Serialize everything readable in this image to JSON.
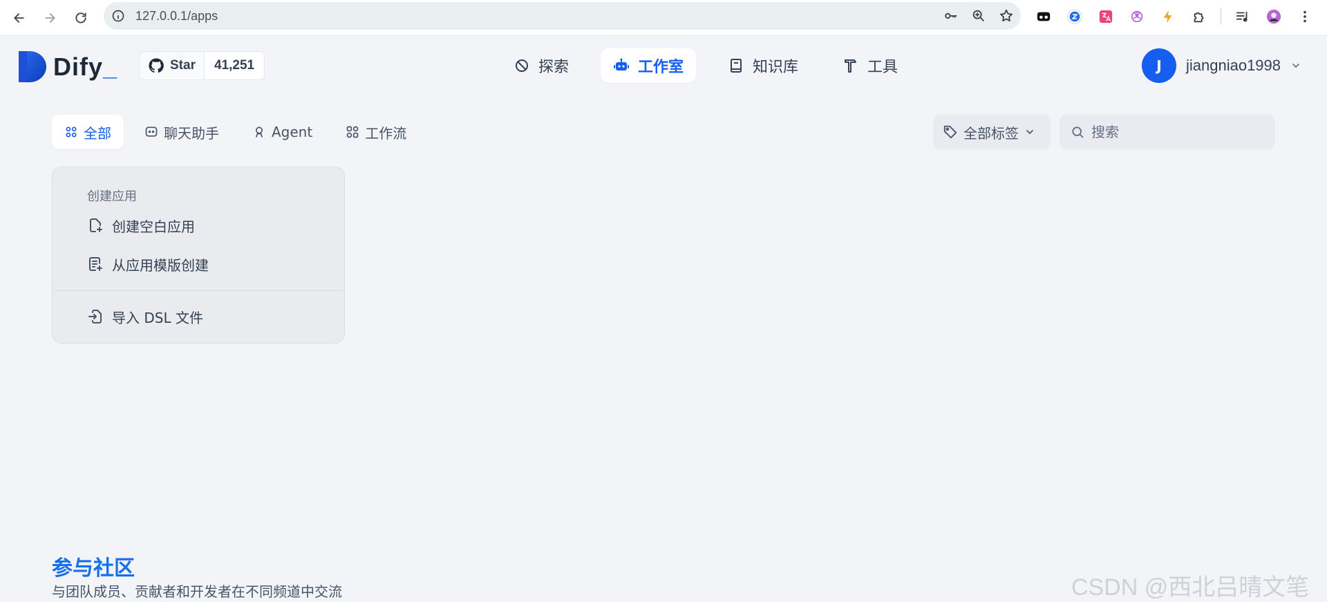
{
  "browser": {
    "url": "127.0.0.1/apps"
  },
  "header": {
    "logo_text": "Dify",
    "logo_cursor": "_",
    "star_label": "Star",
    "star_count": "41,251",
    "nav": [
      {
        "label": "探索",
        "icon": "explore-icon"
      },
      {
        "label": "工作室",
        "icon": "robot-icon",
        "active": true
      },
      {
        "label": "知识库",
        "icon": "book-icon"
      },
      {
        "label": "工具",
        "icon": "hammer-icon"
      }
    ],
    "user": {
      "initial": "J",
      "name": "jiangniao1998"
    }
  },
  "filters": {
    "tabs": [
      {
        "label": "全部",
        "active": true
      },
      {
        "label": "聊天助手"
      },
      {
        "label": "Agent"
      },
      {
        "label": "工作流"
      }
    ],
    "tag_filter": "全部标签",
    "search_placeholder": "搜索"
  },
  "create": {
    "title": "创建应用",
    "blank": "创建空白应用",
    "template": "从应用模版创建",
    "import_dsl": "导入 DSL 文件"
  },
  "community": {
    "title": "参与社区",
    "subtitle": "与团队成员、贡献者和开发者在不同频道中交流"
  },
  "watermark": "CSDN @西北吕晴文笔",
  "colors": {
    "accent": "#155eef",
    "background": "#f2f4f7"
  }
}
